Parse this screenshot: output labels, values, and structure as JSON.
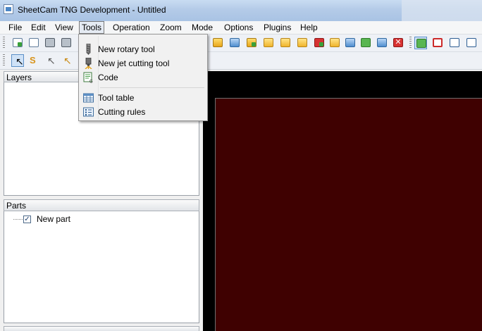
{
  "window": {
    "title": "SheetCam TNG Development - Untitled"
  },
  "menubar": {
    "items": [
      "File",
      "Edit",
      "View",
      "Tools",
      "Operation",
      "Zoom",
      "Mode",
      "Options",
      "Plugins",
      "Help"
    ]
  },
  "tools_menu": {
    "items": [
      {
        "label": "New rotary tool",
        "icon": "rotary-tool-icon"
      },
      {
        "label": "New jet cutting tool",
        "icon": "jet-tool-icon"
      },
      {
        "label": "Code",
        "icon": "code-icon"
      },
      {
        "label": "Tool table",
        "icon": "tool-table-icon"
      },
      {
        "label": "Cutting rules",
        "icon": "cutting-rules-icon"
      }
    ]
  },
  "panels": {
    "layers": {
      "title": "Layers"
    },
    "parts": {
      "title": "Parts",
      "items": [
        {
          "label": "New part",
          "checked": true
        }
      ]
    }
  },
  "colors": {
    "canvas_background": "#000000",
    "sheet_fill": "#3f0101",
    "titlebar": "#b4cbe8"
  }
}
